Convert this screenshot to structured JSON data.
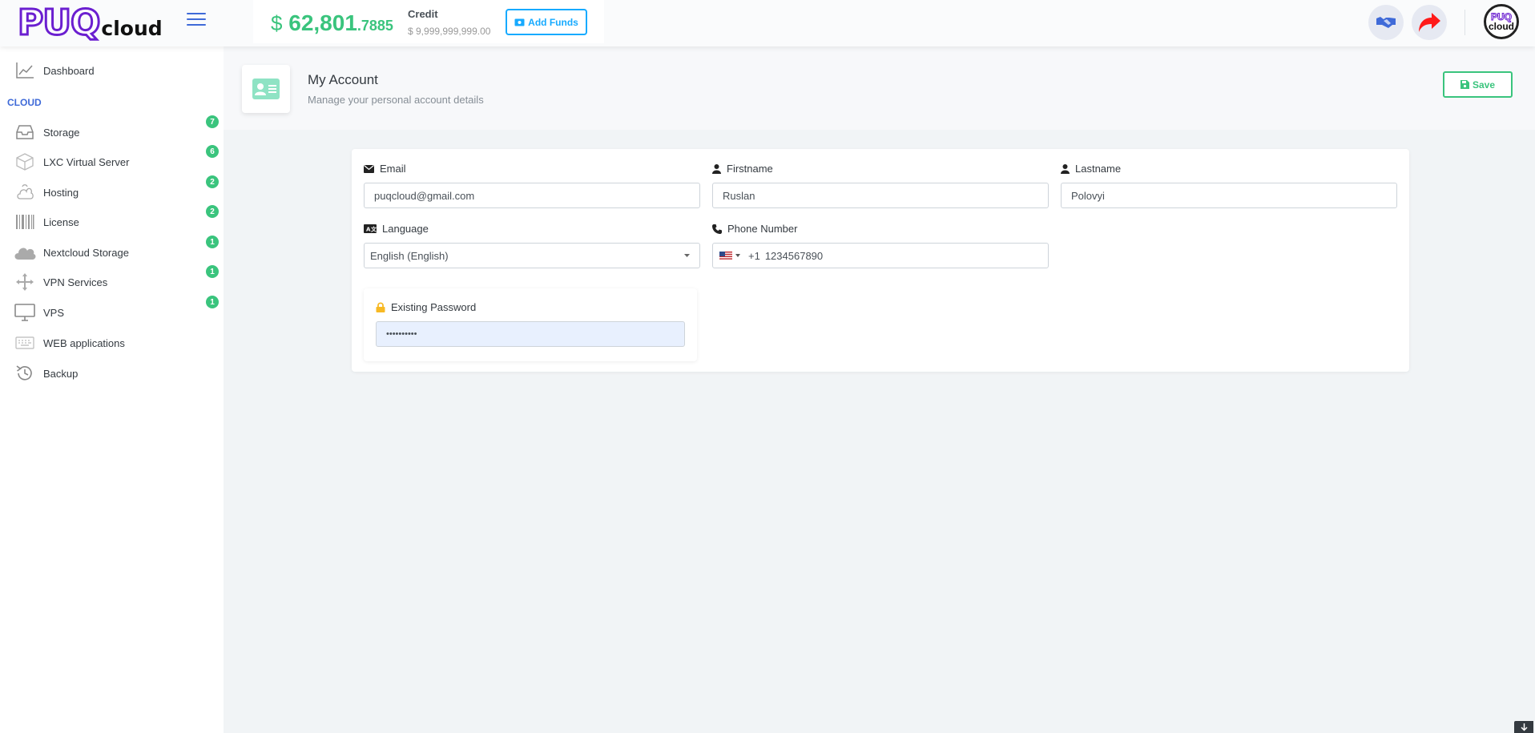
{
  "header": {
    "logo_main": "PUQ",
    "logo_sub": "cloud",
    "balance_currency": "$",
    "balance_whole": "62,801",
    "balance_decimal": ".7885",
    "credit_label": "Credit",
    "credit_value": "$ 9,999,999,999.00",
    "add_funds_label": "Add Funds",
    "avatar_line1": "PUQ",
    "avatar_line2": "cloud"
  },
  "sidebar": {
    "dashboard": "Dashboard",
    "section_heading": "CLOUD",
    "items": [
      {
        "label": "Storage",
        "badge": "7",
        "icon": "inbox-icon"
      },
      {
        "label": "LXC Virtual Server",
        "badge": "6",
        "icon": "cube-icon"
      },
      {
        "label": "Hosting",
        "badge": "2",
        "icon": "cloud-upload-icon"
      },
      {
        "label": "License",
        "badge": "2",
        "icon": "barcode-icon"
      },
      {
        "label": "Nextcloud Storage",
        "badge": "1",
        "icon": "cloud-icon"
      },
      {
        "label": "VPN Services",
        "badge": "1",
        "icon": "arrows-move-icon"
      },
      {
        "label": "VPS",
        "badge": "1",
        "icon": "monitor-icon"
      },
      {
        "label": "WEB applications",
        "badge": "",
        "icon": "keyboard-icon"
      },
      {
        "label": "Backup",
        "badge": "",
        "icon": "history-icon"
      }
    ]
  },
  "page": {
    "title": "My Account",
    "subtitle": "Manage your personal account details",
    "save_label": "Save"
  },
  "form": {
    "email_label": "Email",
    "email_value": "puqcloud@gmail.com",
    "firstname_label": "Firstname",
    "firstname_value": "Ruslan",
    "lastname_label": "Lastname",
    "lastname_value": "Polovyi",
    "language_label": "Language",
    "language_value": "English (English)",
    "phone_label": "Phone Number",
    "phone_code": "+1",
    "phone_value": "1234567890",
    "password_label": "Existing Password",
    "password_value": "••••••••••"
  },
  "colors": {
    "accent": "#3f6ad8",
    "success": "#3ac47d",
    "info": "#16aaff",
    "danger": "#ff1a1a",
    "warning": "#f7b924"
  }
}
